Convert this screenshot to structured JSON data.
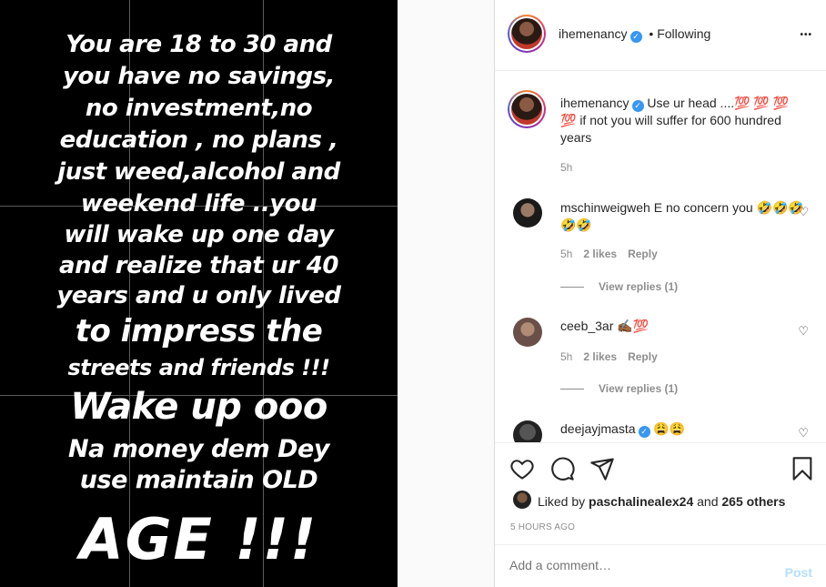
{
  "story": {
    "lines": [
      "You are 18 to 30 and",
      "you have no savings,",
      "no investment,no",
      "education , no plans ,",
      "just weed,alcohol and",
      "weekend life ..you",
      "will wake up one day",
      "and realize that ur 40",
      "years and u only lived",
      "to impress the",
      "streets and friends !!!",
      "Wake up ooo",
      "Na money dem Dey",
      "use maintain OLD",
      "AGE !!!"
    ]
  },
  "header": {
    "username": "ihemenancy",
    "verified": "✓",
    "separator": "•",
    "follow_status": "Following",
    "more": "•••"
  },
  "caption": {
    "username": "ihemenancy",
    "text": "Use ur head ....💯 💯 💯 💯 if not you will suffer for 600 hundred years",
    "time": "5h"
  },
  "comments": [
    {
      "username": "mschinweigweh",
      "text": "E no concern you 🤣🤣🤣🤣🤣",
      "time": "5h",
      "likes": "2 likes",
      "reply": "Reply",
      "view_replies": "View replies (1)"
    },
    {
      "username": "ceeb_3ar",
      "text": "✍🏾💯",
      "time": "5h",
      "likes": "2 likes",
      "reply": "Reply",
      "view_replies": "View replies (1)"
    },
    {
      "username": "deejayjmasta",
      "text": "😩😩"
    }
  ],
  "actions": {
    "liked_prefix": "Liked by",
    "liked_user": "paschalinealex24",
    "liked_and": "and",
    "liked_others": "265 others",
    "timestamp": "5 HOURS AGO"
  },
  "add_comment": {
    "placeholder": "Add a comment…",
    "post_label": "Post"
  },
  "colors": {
    "accent": "#3897f0",
    "post_disabled": "#b2dffc",
    "muted": "#8e8e8e"
  }
}
